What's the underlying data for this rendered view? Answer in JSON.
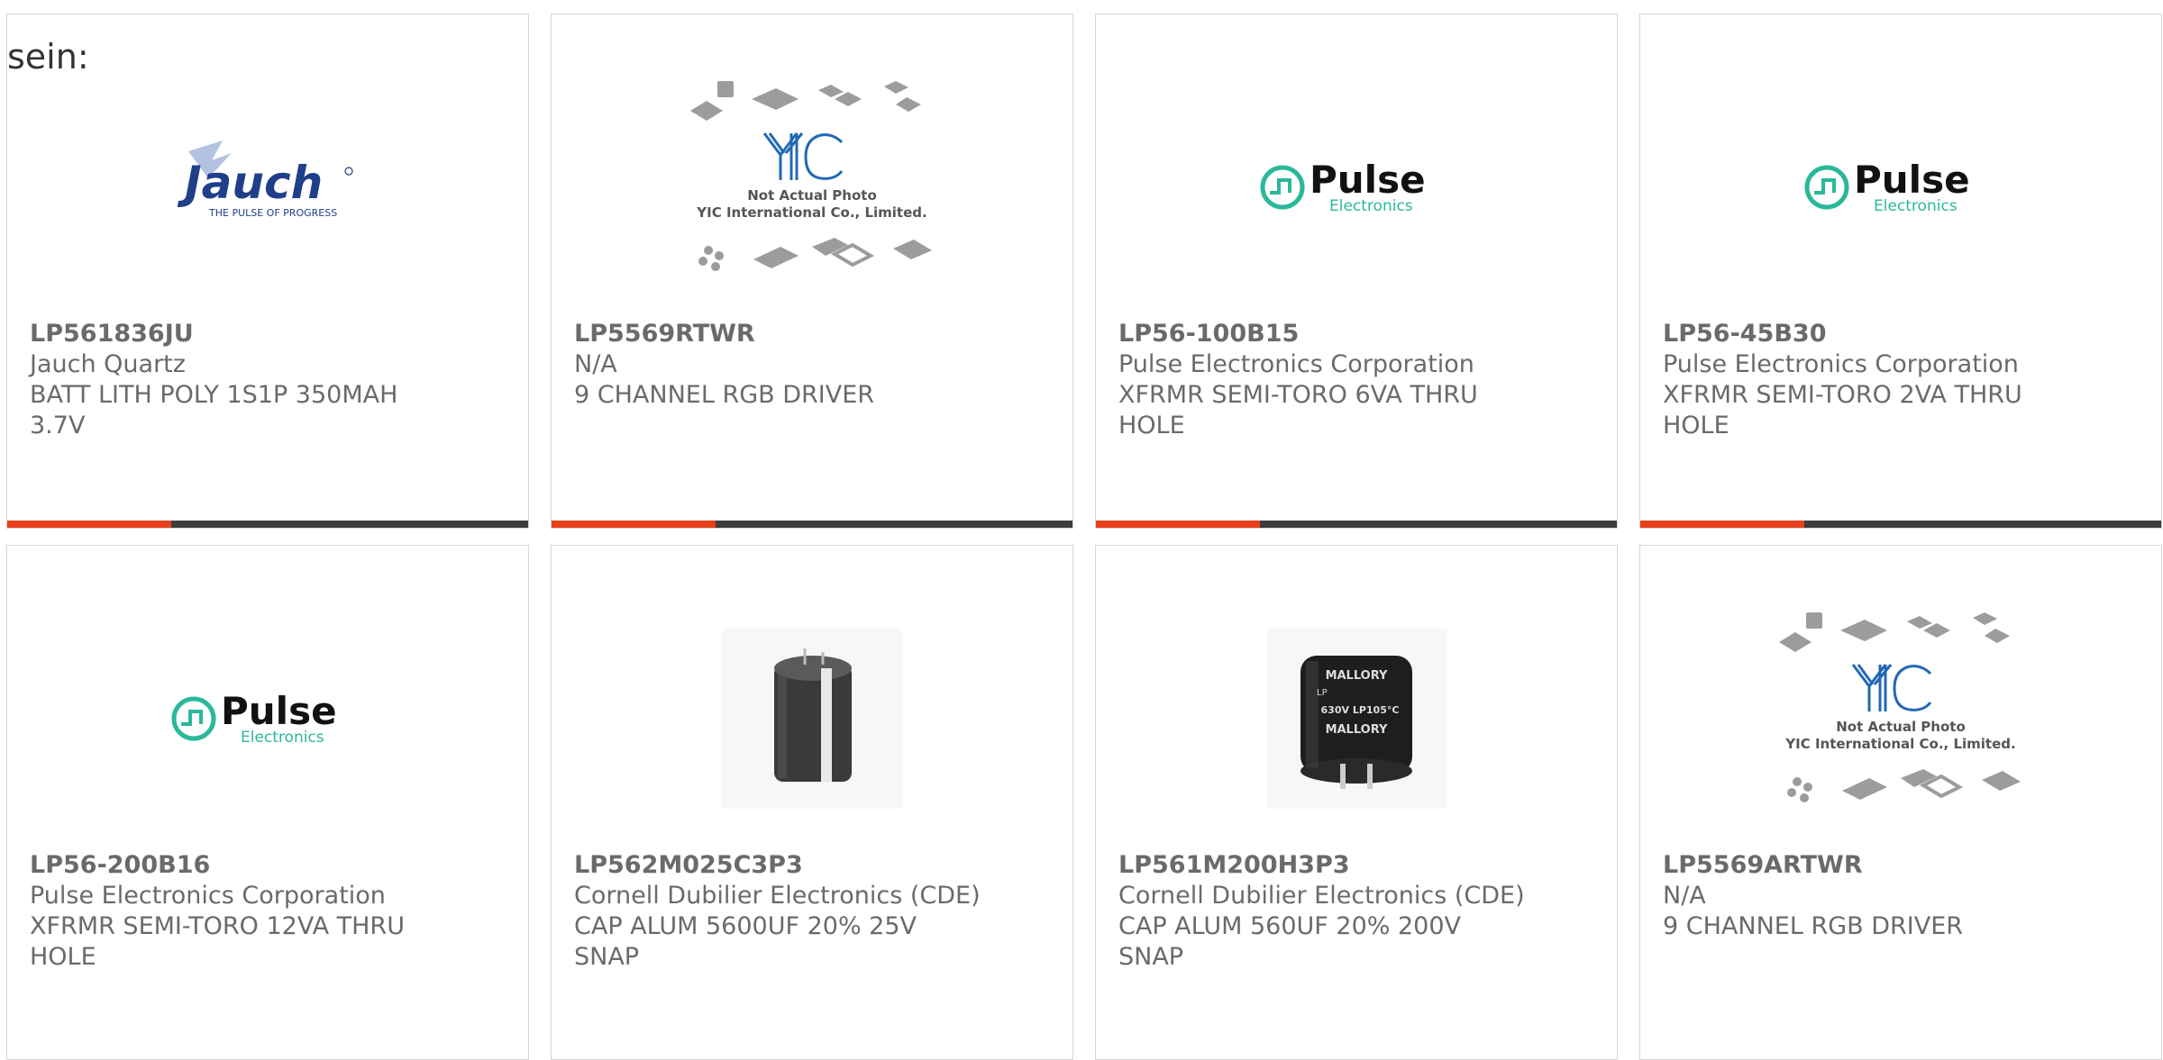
{
  "page": {
    "label": "sein:"
  },
  "colors": {
    "accent": "#e8401c",
    "bar": "#3d3d3d",
    "pulse_green": "#2bb89a",
    "jauch_blue": "#1f3f8a",
    "yic_blue": "#2268b5"
  },
  "cards": [
    {
      "part_number": "LP561836JU",
      "manufacturer": "Jauch Quartz",
      "desc_line1": "BATT LITH POLY 1S1P 350MAH",
      "desc_line2": "3.7V",
      "image": "jauch-logo",
      "logo_text": "Jauch",
      "logo_tagline": "THE PULSE OF PROGRESS"
    },
    {
      "part_number": "LP5569RTWR",
      "manufacturer": "N/A",
      "desc_line1": "9 CHANNEL RGB DRIVER",
      "desc_line2": "",
      "image": "yic-placeholder",
      "logo_text": "YIC",
      "note_line1": "Not Actual Photo",
      "note_line2": "YIC International Co., Limited."
    },
    {
      "part_number": "LP56-100B15",
      "manufacturer": "Pulse Electronics Corporation",
      "desc_line1": "XFRMR SEMI-TORO 6VA THRU",
      "desc_line2": "HOLE",
      "image": "pulse-logo",
      "logo_text": "Pulse",
      "logo_sub": "Electronics"
    },
    {
      "part_number": "LP56-45B30",
      "manufacturer": "Pulse Electronics Corporation",
      "desc_line1": "XFRMR SEMI-TORO 2VA THRU",
      "desc_line2": "HOLE",
      "image": "pulse-logo",
      "logo_text": "Pulse",
      "logo_sub": "Electronics"
    },
    {
      "part_number": "LP56-200B16",
      "manufacturer": "Pulse Electronics Corporation",
      "desc_line1": "XFRMR SEMI-TORO 12VA THRU",
      "desc_line2": "HOLE",
      "image": "pulse-logo",
      "logo_text": "Pulse",
      "logo_sub": "Electronics"
    },
    {
      "part_number": "LP562M025C3P3",
      "manufacturer": "Cornell Dubilier Electronics (CDE)",
      "desc_line1": "CAP ALUM 5600UF 20% 25V",
      "desc_line2": "SNAP",
      "image": "capacitor-photo"
    },
    {
      "part_number": "LP561M200H3P3",
      "manufacturer": "Cornell Dubilier Electronics (CDE)",
      "desc_line1": "CAP ALUM 560UF 20% 200V",
      "desc_line2": "SNAP",
      "image": "mallory-capacitor-photo",
      "label_line1": "MALLORY",
      "label_line2": "LP",
      "label_line3": "630V LP105°C"
    },
    {
      "part_number": "LP5569ARTWR",
      "manufacturer": "N/A",
      "desc_line1": "9 CHANNEL RGB DRIVER",
      "desc_line2": "",
      "image": "yic-placeholder",
      "logo_text": "YIC",
      "note_line1": "Not Actual Photo",
      "note_line2": "YIC International Co., Limited."
    }
  ]
}
